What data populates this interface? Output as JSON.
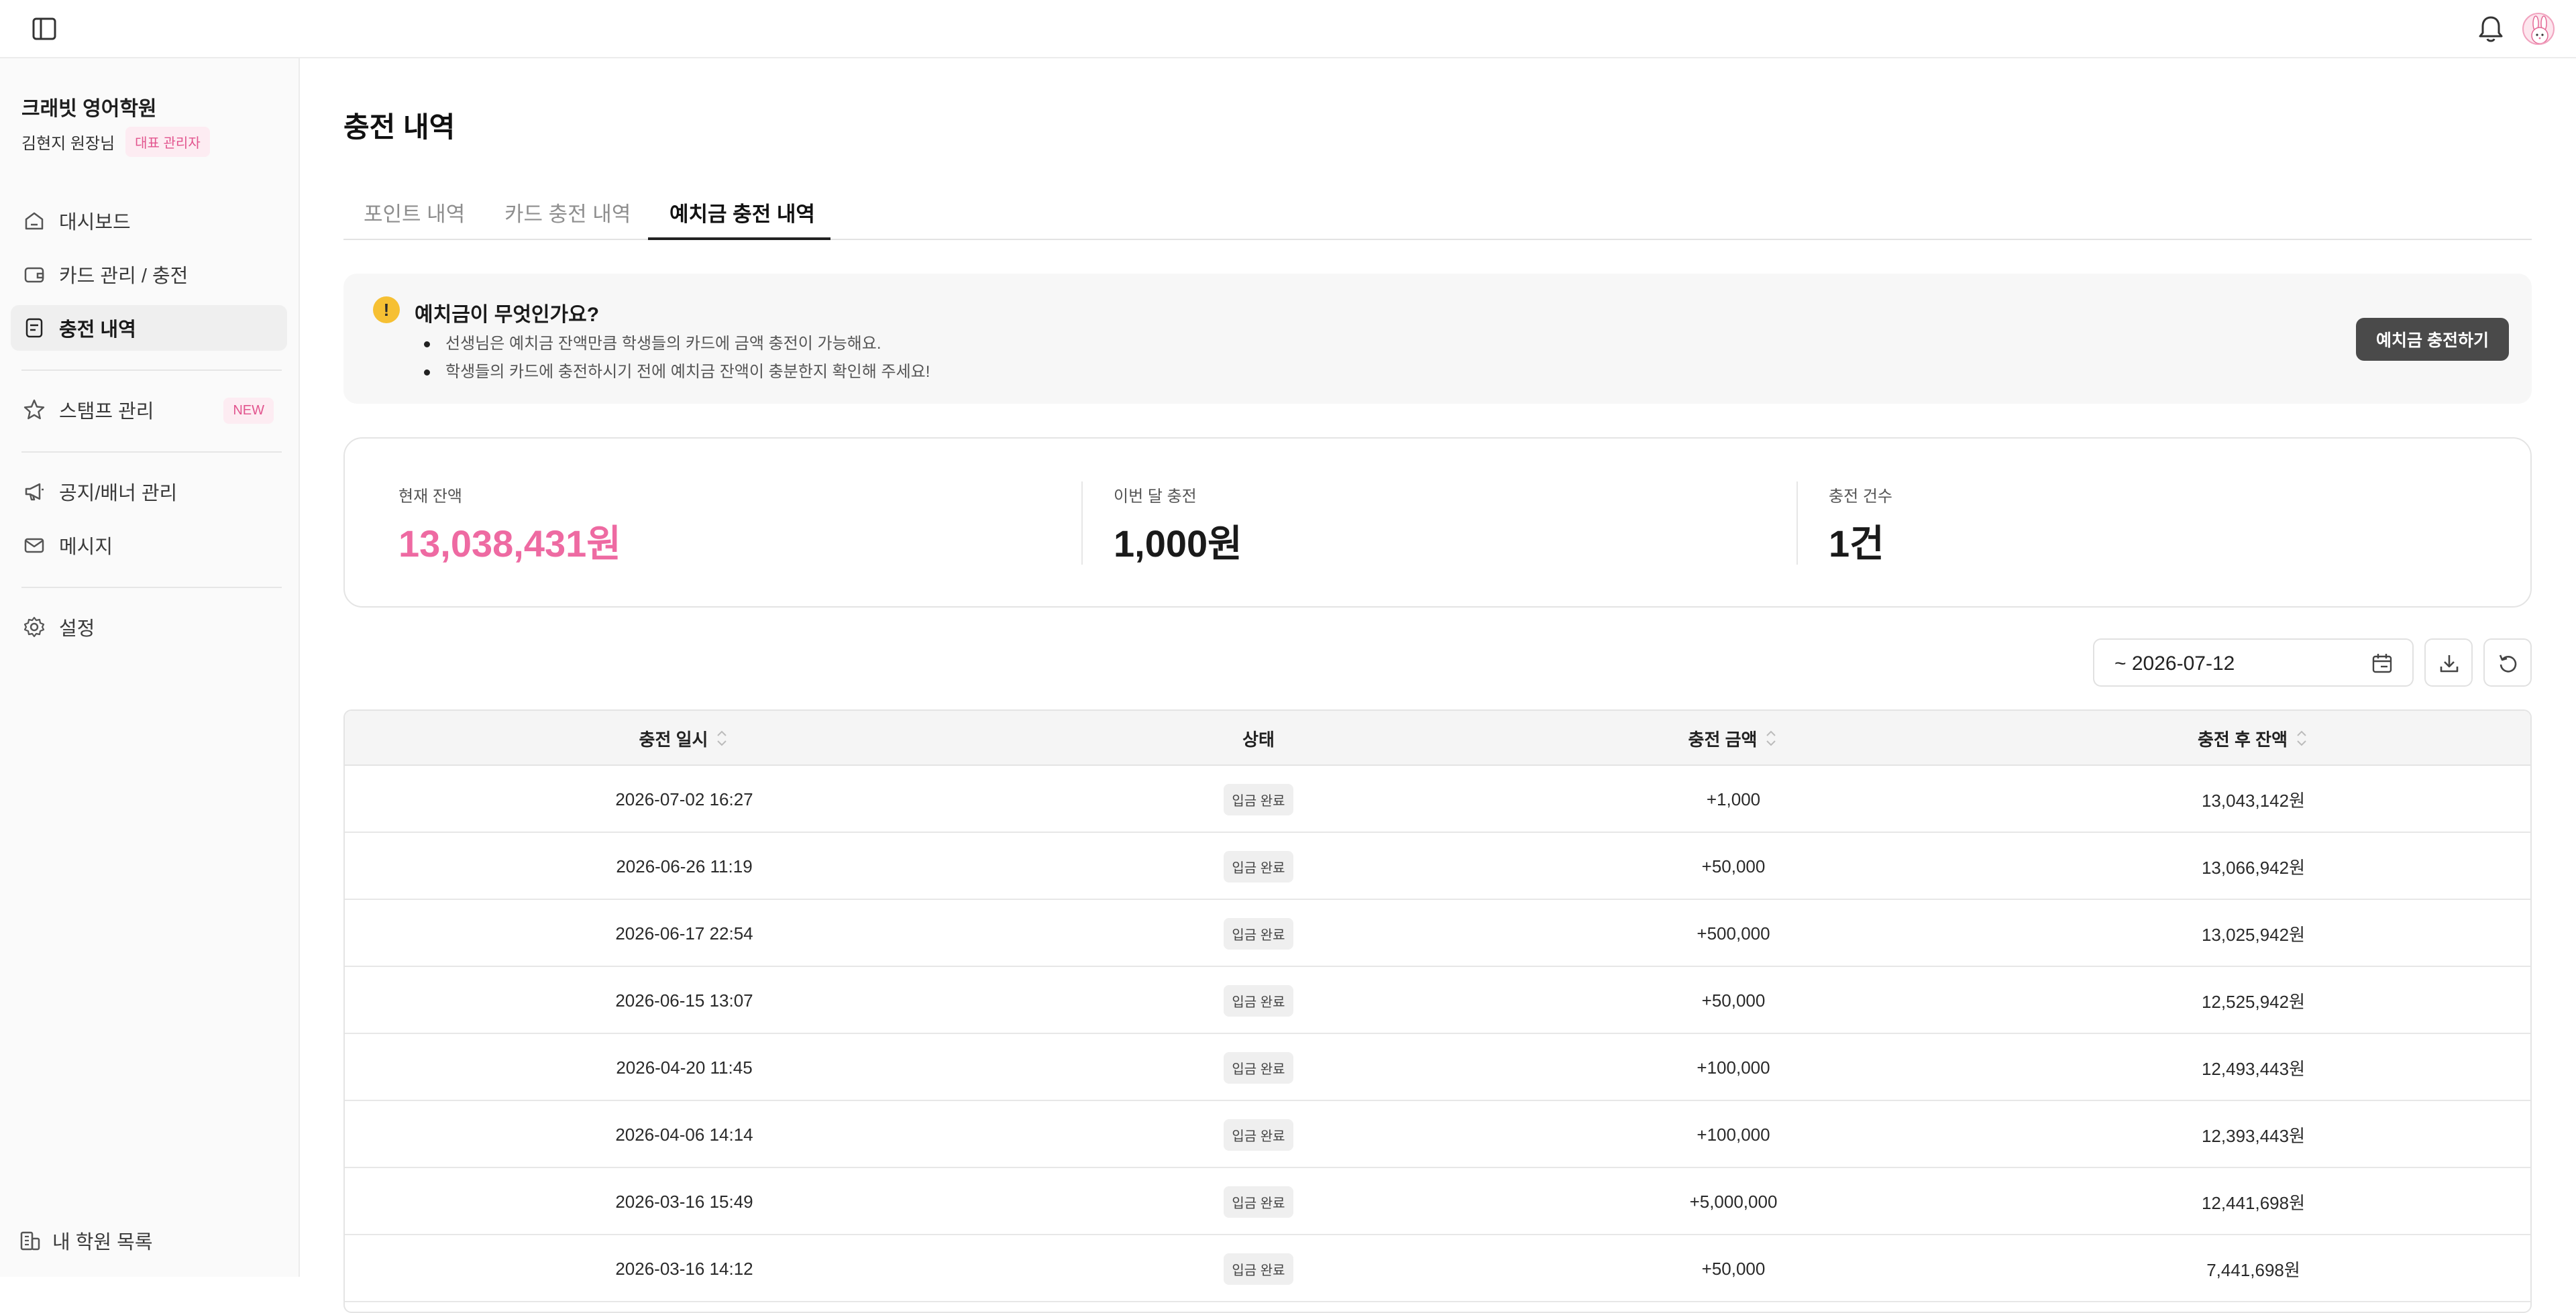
{
  "sidebar": {
    "org_name": "크래빗 영어학원",
    "user_name": "김현지 원장님",
    "role": "대표 관리자",
    "items": [
      {
        "label": "대시보드"
      },
      {
        "label": "카드 관리 / 충전"
      },
      {
        "label": "충전 내역"
      },
      {
        "label": "스탬프 관리",
        "badge": "NEW"
      },
      {
        "label": "공지/배너 관리"
      },
      {
        "label": "메시지"
      },
      {
        "label": "설정"
      }
    ],
    "bottom_link": "내 학원 목록"
  },
  "main": {
    "title": "충전 내역",
    "tabs": [
      {
        "label": "포인트 내역"
      },
      {
        "label": "카드 충전 내역"
      },
      {
        "label": "예치금 충전 내역"
      }
    ],
    "info": {
      "title": "예치금이 무엇인가요?",
      "lines": [
        "선생님은 예치금 잔액만큼 학생들의 카드에 금액 충전이 가능해요.",
        "학생들의 카드에 충전하시기 전에 예치금 잔액이 충분한지 확인해 주세요!"
      ],
      "button": "예치금 충전하기"
    },
    "summary": {
      "balance_label": "현재 잔액",
      "balance_value": "13,038,431원",
      "month_label": "이번 달 충전",
      "month_value": "1,000원",
      "count_label": "충전 건수",
      "count_value": "1건"
    },
    "filter": {
      "date": "~ 2026-07-12"
    },
    "table": {
      "headers": [
        "충전 일시",
        "상태",
        "충전 금액",
        "충전 후 잔액"
      ],
      "rows": [
        {
          "datetime": "2026-07-02 16:27",
          "status": "입금 완료",
          "amount": "+1,000",
          "balance": "13,043,142원"
        },
        {
          "datetime": "2026-06-26 11:19",
          "status": "입금 완료",
          "amount": "+50,000",
          "balance": "13,066,942원"
        },
        {
          "datetime": "2026-06-17 22:54",
          "status": "입금 완료",
          "amount": "+500,000",
          "balance": "13,025,942원"
        },
        {
          "datetime": "2026-06-15 13:07",
          "status": "입금 완료",
          "amount": "+50,000",
          "balance": "12,525,942원"
        },
        {
          "datetime": "2026-04-20 11:45",
          "status": "입금 완료",
          "amount": "+100,000",
          "balance": "12,493,443원"
        },
        {
          "datetime": "2026-04-06 14:14",
          "status": "입금 완료",
          "amount": "+100,000",
          "balance": "12,393,443원"
        },
        {
          "datetime": "2026-03-16 15:49",
          "status": "입금 완료",
          "amount": "+5,000,000",
          "balance": "12,441,698원"
        },
        {
          "datetime": "2026-03-16 14:12",
          "status": "입금 완료",
          "amount": "+50,000",
          "balance": "7,441,698원"
        }
      ]
    }
  }
}
